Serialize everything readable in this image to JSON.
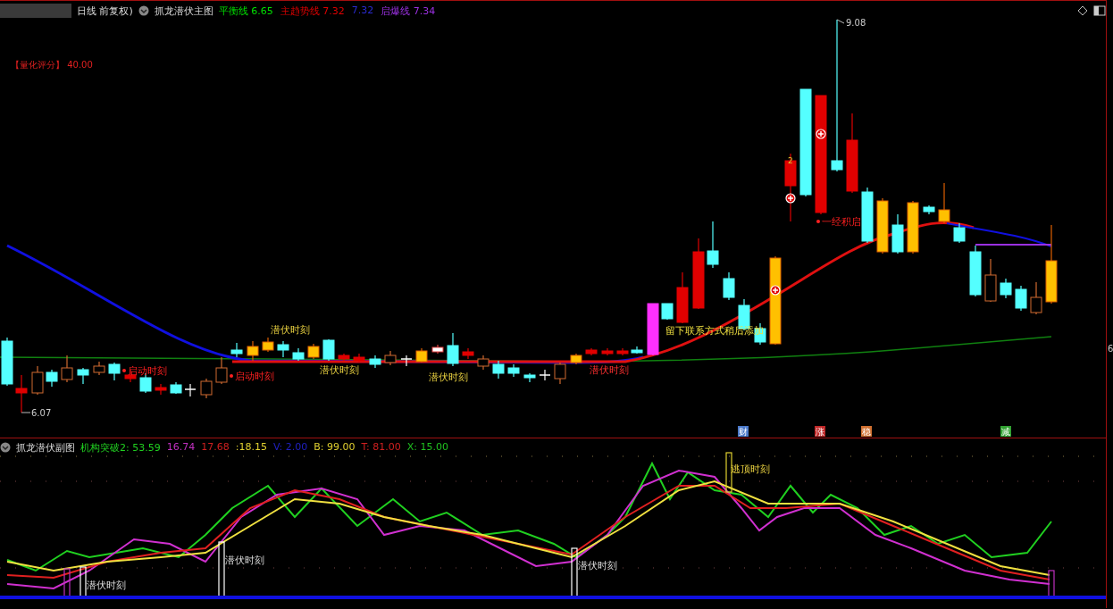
{
  "main_panel": {
    "period": "日线 前复权)",
    "indicator": "抓龙潜伏主图",
    "legend": [
      {
        "label": "平衡线",
        "value": "6.65",
        "color": "#00e000"
      },
      {
        "label": "主趋势线",
        "value": "7.32",
        "color": "#e00000"
      },
      {
        "value": "7.32",
        "color": "#2a2ad0"
      },
      {
        "label": "启爆线",
        "value": "7.34",
        "color": "#9a30e0"
      }
    ],
    "score": {
      "label": "【量化评分】",
      "value": "40.00"
    },
    "high_price": "9.08",
    "low_price": "6.07",
    "mark_label": "2",
    "axis_label": "6",
    "signals": [
      {
        "kind": "start",
        "text": "启动时刻"
      },
      {
        "kind": "start",
        "text": "启动时刻"
      },
      {
        "kind": "latent",
        "text": "潜伏时刻"
      },
      {
        "kind": "latent",
        "text": "潜伏时刻"
      },
      {
        "kind": "latent",
        "text": "潜伏时刻"
      },
      {
        "kind": "latent_red",
        "text": "潜伏时刻"
      },
      {
        "kind": "note",
        "text": "留下联系方式稍后添加"
      },
      {
        "kind": "start",
        "text": "一经积启"
      }
    ],
    "event_tags": [
      {
        "text": "财",
        "color": "#4a78c8"
      },
      {
        "text": "涨",
        "color": "#c02828"
      },
      {
        "text": "稳",
        "color": "#d07030"
      },
      {
        "text": "减",
        "color": "#30a030"
      }
    ]
  },
  "sub_panel": {
    "indicator": "抓龙潜伏副图",
    "legend": [
      {
        "label": "机构突破2:",
        "value": "53.59",
        "color": "#20d020"
      },
      {
        "value": "16.74",
        "color": "#c030c0"
      },
      {
        "value": "17.68",
        "color": "#d02020"
      },
      {
        "value": ":18.15",
        "color": "#e0d030"
      },
      {
        "label": "V:",
        "value": "2.00",
        "color": "#2020c0"
      },
      {
        "label": "B:",
        "value": "99.00",
        "color": "#e0d030"
      },
      {
        "label": "T:",
        "value": "81.00",
        "color": "#d02020"
      },
      {
        "label": "X:",
        "value": "15.00",
        "color": "#20c020"
      }
    ],
    "signals": [
      {
        "kind": "latent",
        "text": "潜伏时刻"
      },
      {
        "kind": "latent",
        "text": "潜伏时刻"
      },
      {
        "kind": "latent",
        "text": "潜伏时刻"
      },
      {
        "kind": "top",
        "text": "逃顶时刻"
      }
    ]
  }
}
